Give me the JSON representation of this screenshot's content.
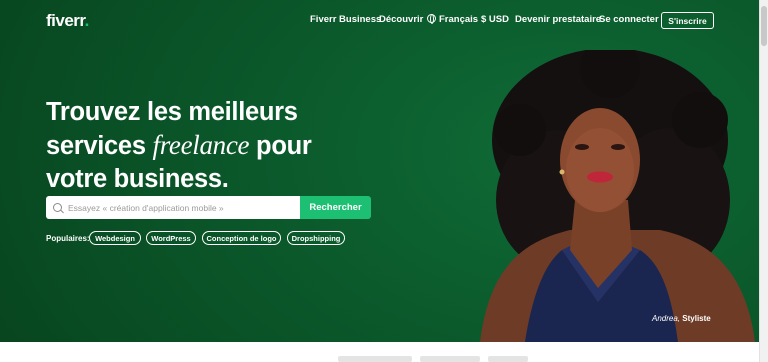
{
  "logo": {
    "text": "fiverr",
    "dot": "."
  },
  "nav": {
    "business": "Fiverr Business",
    "explore": "Découvrir",
    "language": "Français",
    "currency": "$ USD",
    "seller": "Devenir prestataire",
    "signin": "Se connecter",
    "join": "S'inscrire"
  },
  "hero": {
    "line1": "Trouvez les meilleurs",
    "line2_start": "services",
    "line2_em": "freelance",
    "line2_end": "pour",
    "line3": "votre business."
  },
  "search": {
    "placeholder": "Essayez « création d'application mobile »",
    "button": "Rechercher"
  },
  "popular": {
    "label": "Populaires:",
    "tags": [
      "Webdesign",
      "WordPress",
      "Conception de logo",
      "Dropshipping"
    ]
  },
  "caption": {
    "name": "Andrea,",
    "role": "Styliste"
  },
  "colors": {
    "hero_bg": "#0b5a2c",
    "accent": "#1dbf73"
  }
}
